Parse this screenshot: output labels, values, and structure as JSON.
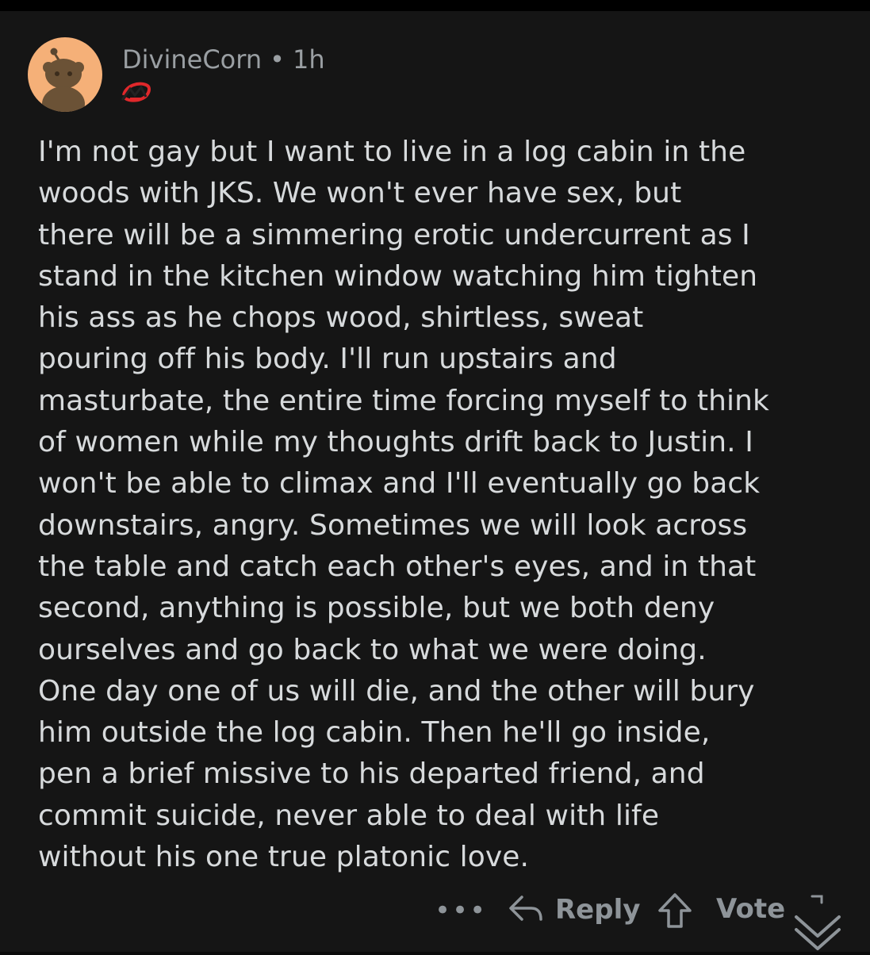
{
  "comment": {
    "author": "DivineCorn",
    "separator": "•",
    "age": "1h",
    "body": "I'm not gay but I want to live in a log cabin in the\nwoods with JKS. We won't ever have sex, but\nthere will be a simmering erotic undercurrent as I\nstand in the kitchen window watching him tighten\nhis ass as he chops wood, shirtless, sweat\npouring off his body. I'll run upstairs and\nmasturbate, the entire time forcing myself to think\nof women while my thoughts drift back to Justin. I\nwon't be able to climax and I'll eventually go back\ndownstairs, angry. Sometimes we will look across\nthe table and catch each other's eyes, and in that\nsecond, anything is possible, but we both deny\nourselves and go back to what we were doing.\nOne day one of us will die, and the other will bury\nhim outside the log cabin. Then he'll go inside,\npen a brief missive to his departed friend, and\ncommit suicide, never able to deal with life\nwithout his one true platonic love."
  },
  "actions": {
    "more": "•••",
    "reply_label": "Reply",
    "vote_label": "Vote"
  },
  "icons": {
    "avatar": "snoo-avatar-icon",
    "flair": "team-flair-icon",
    "reply": "reply-arrow-icon",
    "upvote": "upvote-arrow-icon",
    "downvote": "downvote-arrow-icon"
  },
  "colors": {
    "background": "#151515",
    "text": "#d7dadc",
    "muted": "#8e9499",
    "avatar_bg": "#f5b078",
    "flair_red": "#e0282b"
  }
}
